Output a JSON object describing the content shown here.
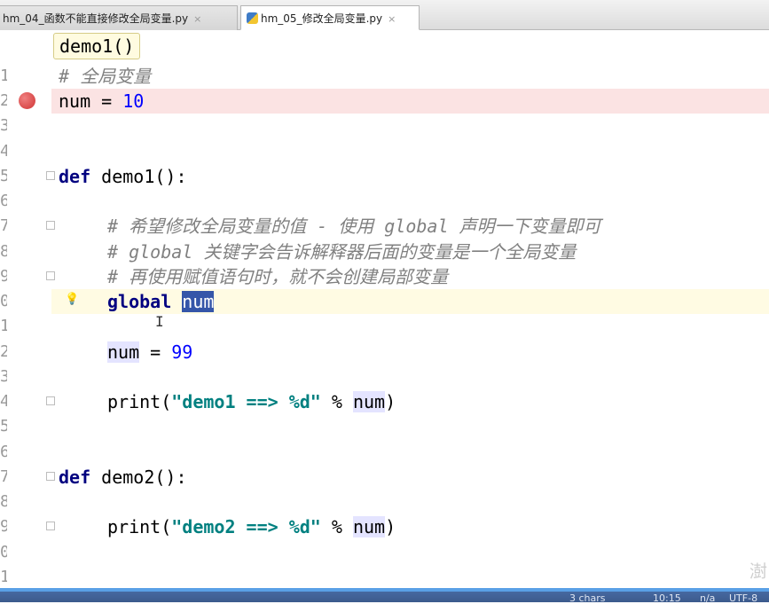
{
  "tabs": [
    {
      "label": "hm_04_函数不能直接修改全局变量.py",
      "close": "×",
      "active": false
    },
    {
      "label": "hm_05_修改全局变量.py",
      "close": "×",
      "active": true
    }
  ],
  "breadcrumb": "demo1()",
  "line_numbers": [
    "1",
    "2",
    "3",
    "4",
    "5",
    "6",
    "7",
    "8",
    "9",
    "0",
    "1",
    "2",
    "3",
    "4",
    "5",
    "6",
    "7",
    "8",
    "9",
    "0",
    "1"
  ],
  "code": {
    "l1_comment": "# 全局变量",
    "l2_var": "num",
    "l2_eq": " = ",
    "l2_val": "10",
    "l5_def": "def",
    "l5_name": " demo1():",
    "l7_comment": "# 希望修改全局变量的值 - 使用 global 声明一下变量即可",
    "l8_comment": "# global 关键字会告诉解释器后面的变量是一个全局变量",
    "l9_comment": "# 再使用赋值语句时，就不会创建局部变量",
    "l10_kw": "global",
    "l10_var": "num",
    "l12_var": "num",
    "l12_eq": " = ",
    "l12_val": "99",
    "l14_print": "print(",
    "l14_str": "\"demo1 ==> %d\"",
    "l14_mod": " % ",
    "l14_var": "num",
    "l14_close": ")",
    "l17_def": "def",
    "l17_name": " demo2():",
    "l19_print": "print(",
    "l19_str": "\"demo2 ==> %d\"",
    "l19_mod": " % ",
    "l19_var": "num",
    "l19_close": ")"
  },
  "status": {
    "chars": "3 chars",
    "position": "10:15",
    "na": "n/a",
    "encoding": "UTF-8"
  },
  "watermark": "澍"
}
